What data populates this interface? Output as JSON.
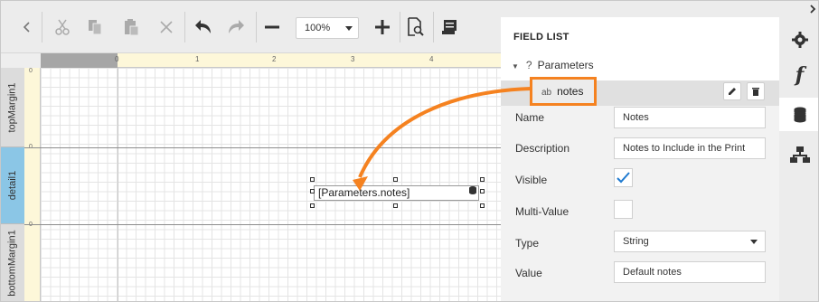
{
  "toolbar": {
    "icons": [
      "back-icon",
      "cut-icon",
      "copy-icon",
      "paste-icon",
      "delete-icon",
      "undo-icon",
      "redo-icon",
      "zoom-out-icon",
      "zoom-in-icon",
      "preview-icon",
      "script-icon"
    ],
    "zoom_value": "100%"
  },
  "ruler": {
    "top_ticks": [
      "0",
      "1",
      "2",
      "3",
      "4"
    ],
    "left_ticks": [
      "0",
      "0",
      "0"
    ]
  },
  "bands": [
    {
      "label": "topMargin1"
    },
    {
      "label": "detail1"
    },
    {
      "label": "bottomMargin1"
    }
  ],
  "design": {
    "field_text": "[Parameters.notes]"
  },
  "field_list": {
    "title": "FIELD LIST",
    "group": "Parameters",
    "group_icon": "?",
    "selected_item": "notes",
    "selected_item_type": "ab",
    "properties": {
      "name_label": "Name",
      "name_value": "Notes",
      "description_label": "Description",
      "description_value": "Notes to Include in the Print",
      "visible_label": "Visible",
      "visible_checked": true,
      "multivalue_label": "Multi-Value",
      "multivalue_checked": false,
      "type_label": "Type",
      "type_value": "String",
      "value_label": "Value",
      "value_value": "Default notes"
    }
  },
  "sidebar": {
    "tabs": [
      "gear-icon",
      "function-icon",
      "database-icon",
      "hierarchy-icon"
    ],
    "active": "database-icon"
  },
  "colors": {
    "highlight": "#f58220",
    "band_detail": "#8bc6e6",
    "check": "#1f7ad0"
  }
}
